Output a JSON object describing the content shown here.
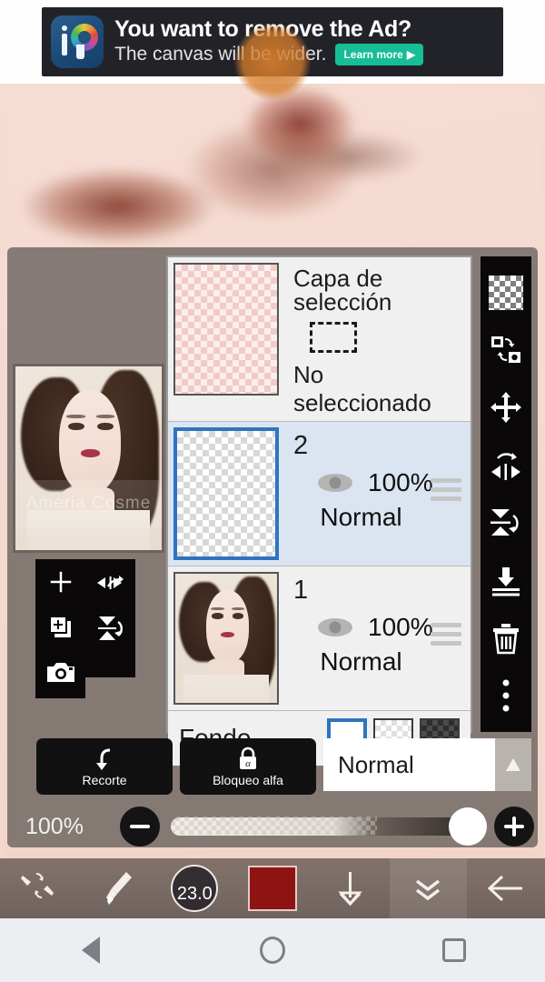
{
  "ad": {
    "logo_icon": "ibispaint-logo-icon",
    "title": "You want to remove the Ad?",
    "subtitle": "The canvas will be wider.",
    "cta_label": "Learn more",
    "cta_arrow": "▶",
    "cta_color": "#16bd96",
    "background_color": "#222328"
  },
  "canvas": {
    "description": "zoomed blurred skin and lips artwork"
  },
  "layers_panel": {
    "preview_watermark": "Ameria Cosme",
    "left_tools": [
      {
        "name": "add-layer-button",
        "icon": "plus-icon"
      },
      {
        "name": "flip-horizontal-button",
        "icon": "flip-horizontal-icon"
      },
      {
        "name": "duplicate-layer-button",
        "icon": "duplicate-layer-icon"
      },
      {
        "name": "flip-vertical-button",
        "icon": "flip-vertical-icon"
      },
      {
        "name": "camera-button",
        "icon": "camera-icon"
      }
    ],
    "right_tools": [
      {
        "name": "transparency-button",
        "icon": "checkerboard-icon"
      },
      {
        "name": "swap-layers-button",
        "icon": "swap-layers-icon"
      },
      {
        "name": "move-layer-button",
        "icon": "move-arrows-icon"
      },
      {
        "name": "rotate-flip-horizontal-button",
        "icon": "rotate-flip-horizontal-icon"
      },
      {
        "name": "rotate-flip-vertical-button",
        "icon": "rotate-flip-vertical-icon"
      },
      {
        "name": "merge-down-button",
        "icon": "merge-down-icon"
      },
      {
        "name": "delete-layer-button",
        "icon": "trash-icon"
      },
      {
        "name": "more-options-button",
        "icon": "more-vertical-icon"
      }
    ],
    "selection_layer": {
      "title": "Capa de selección",
      "status": "No seleccionado"
    },
    "layers": [
      {
        "name": "2",
        "opacity": "100%",
        "blend": "Normal",
        "selected": true,
        "thumb": "transparent"
      },
      {
        "name": "1",
        "opacity": "100%",
        "blend": "Normal",
        "selected": false,
        "thumb": "portrait"
      }
    ],
    "background_row": {
      "label": "Fondo",
      "options": [
        "white",
        "light-checker",
        "dark-checker"
      ],
      "selected_index": 0
    },
    "buttons": {
      "clipping_label": "Recorte",
      "clipping_icon": "clipping-arrow-icon",
      "alpha_lock_label": "Bloqueo alfa",
      "alpha_lock_icon": "alpha-lock-icon"
    },
    "blend_mode": {
      "value": "Normal",
      "arrow_icon": "triangle-up-icon"
    },
    "opacity": {
      "value": "100%",
      "minus_icon": "minus-icon",
      "plus_icon": "plus-icon",
      "slider_percent": 100
    }
  },
  "app_toolbar": [
    {
      "name": "brush-eraser-toggle",
      "icon": "brush-eraser-swap-icon"
    },
    {
      "name": "brush-tool",
      "icon": "brush-icon"
    },
    {
      "name": "brush-size",
      "icon": "brush-size-icon",
      "value": "23.0"
    },
    {
      "name": "color-swatch",
      "icon": "color-swatch-icon",
      "color": "#8e1414"
    },
    {
      "name": "download-button",
      "icon": "arrow-down-icon"
    },
    {
      "name": "collapse-button",
      "icon": "double-chevron-down-icon"
    },
    {
      "name": "back-button",
      "icon": "arrow-left-icon"
    }
  ],
  "navbar": [
    {
      "name": "android-back-button",
      "icon": "triangle-left-icon"
    },
    {
      "name": "android-home-button",
      "icon": "circle-icon"
    },
    {
      "name": "android-recents-button",
      "icon": "square-icon"
    }
  ]
}
